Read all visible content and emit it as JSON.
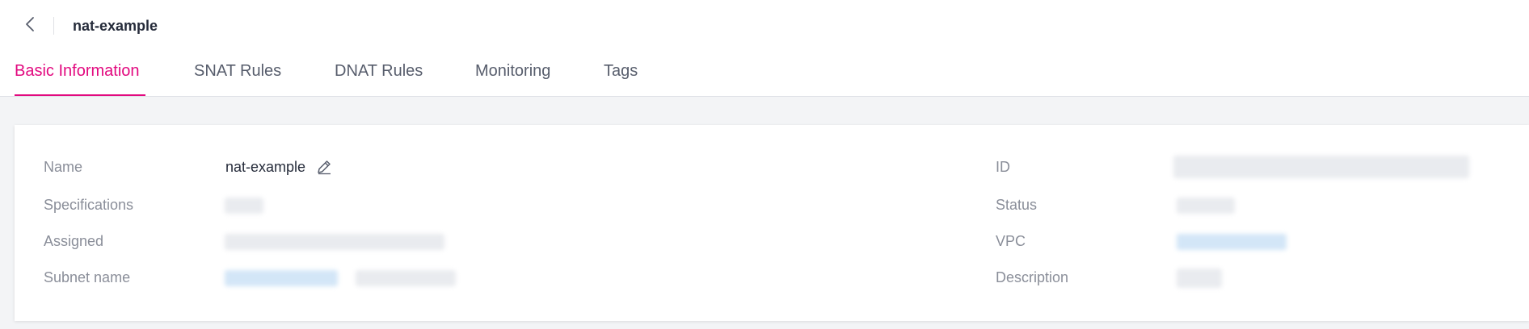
{
  "header": {
    "title": "nat-example"
  },
  "tabs": [
    {
      "label": "Basic Information",
      "active": true
    },
    {
      "label": "SNAT Rules",
      "active": false
    },
    {
      "label": "DNAT Rules",
      "active": false
    },
    {
      "label": "Monitoring",
      "active": false
    },
    {
      "label": "Tags",
      "active": false
    }
  ],
  "details": {
    "left": {
      "name_label": "Name",
      "name_value": "nat-example",
      "specifications_label": "Specifications",
      "assigned_label": "Assigned",
      "subnet_label": "Subnet name"
    },
    "right": {
      "id_label": "ID",
      "status_label": "Status",
      "vpc_label": "VPC",
      "description_label": "Description"
    }
  },
  "colors": {
    "accent": "#e2097f",
    "label": "#8a8e99",
    "text": "#252b3a",
    "link": "#2f7ec9"
  },
  "icons": {
    "back": "chevron-left-icon",
    "edit": "pencil-icon"
  }
}
